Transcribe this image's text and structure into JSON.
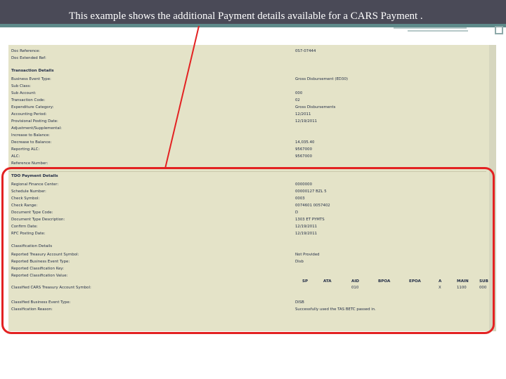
{
  "slide": {
    "title": "This example shows the additional Payment details available for a CARS Payment ."
  },
  "colors": {
    "accent_red": "#e32222",
    "panel_bg": "#e4e3c8",
    "topbar": "#4a4a57"
  },
  "top_rows": [
    {
      "label": "Doc Reference:",
      "value": "0S7-07444"
    },
    {
      "label": "Doc Extended Ref:",
      "value": ""
    }
  ],
  "transaction": {
    "header": "Transaction Details",
    "rows": [
      {
        "label": "Business Event Type:",
        "value": "Gross Disbursement (ED30)"
      },
      {
        "label": "Sub Class:",
        "value": ""
      },
      {
        "label": "Sub Account:",
        "value": "000"
      },
      {
        "label": "Transaction Code:",
        "value": "02"
      },
      {
        "label": "Expenditure Category:",
        "value": "Gross Disbursements"
      },
      {
        "label": "Accounting Period:",
        "value": "12/2011"
      },
      {
        "label": "Provisional Posting Date:",
        "value": "12/19/2011"
      },
      {
        "label": "Adjustment/Supplemental:",
        "value": ""
      },
      {
        "label": "Increase to Balance:",
        "value": ""
      },
      {
        "label": "Decrease to Balance:",
        "value": "14,035.40"
      },
      {
        "label": "Reporting ALC:",
        "value": "9567000"
      },
      {
        "label": "ALC:",
        "value": "9567000"
      },
      {
        "label": "Reference Number:",
        "value": ""
      }
    ]
  },
  "tdo": {
    "header": "TDO Payment Details",
    "rows": [
      {
        "label": "Regional Finance Center:",
        "value": "0000000"
      },
      {
        "label": "Schedule Number:",
        "value": "00000127 BZL 5"
      },
      {
        "label": "Check Symbol:",
        "value": "0003"
      },
      {
        "label": "Check Range:",
        "value": "0074601 0057402"
      },
      {
        "label": "Document Type Code:",
        "value": "D"
      },
      {
        "label": "Document Type Description:",
        "value": "1303 ET PYMTS"
      },
      {
        "label": "Confirm Date:",
        "value": "12/19/2011"
      },
      {
        "label": "RFC Posting Date:",
        "value": "12/19/2011"
      }
    ]
  },
  "classification": {
    "header": "Classification Details",
    "rows": [
      {
        "label": "Reported Treasury Account Symbol:",
        "value": "Not Provided"
      },
      {
        "label": "Reported Business Event Type:",
        "value": "Disb"
      },
      {
        "label": "Reported Classification Key:",
        "value": ""
      },
      {
        "label": "Reported Classification Value:",
        "value": ""
      }
    ],
    "tas_label": "Classified CARS Treasury Account Symbol:",
    "columns": [
      "SP",
      "ATA",
      "AID",
      "BPOA",
      "EPOA",
      "A",
      "MAIN",
      "SUB"
    ],
    "values": [
      "",
      "",
      "010",
      "",
      "",
      "X",
      "1100",
      "000"
    ],
    "tail_rows": [
      {
        "label": "Classified Business Event Type:",
        "value": "DISB"
      },
      {
        "label": "Classification Reason:",
        "value": "Successfully used the TAS BETC passed in."
      }
    ]
  }
}
